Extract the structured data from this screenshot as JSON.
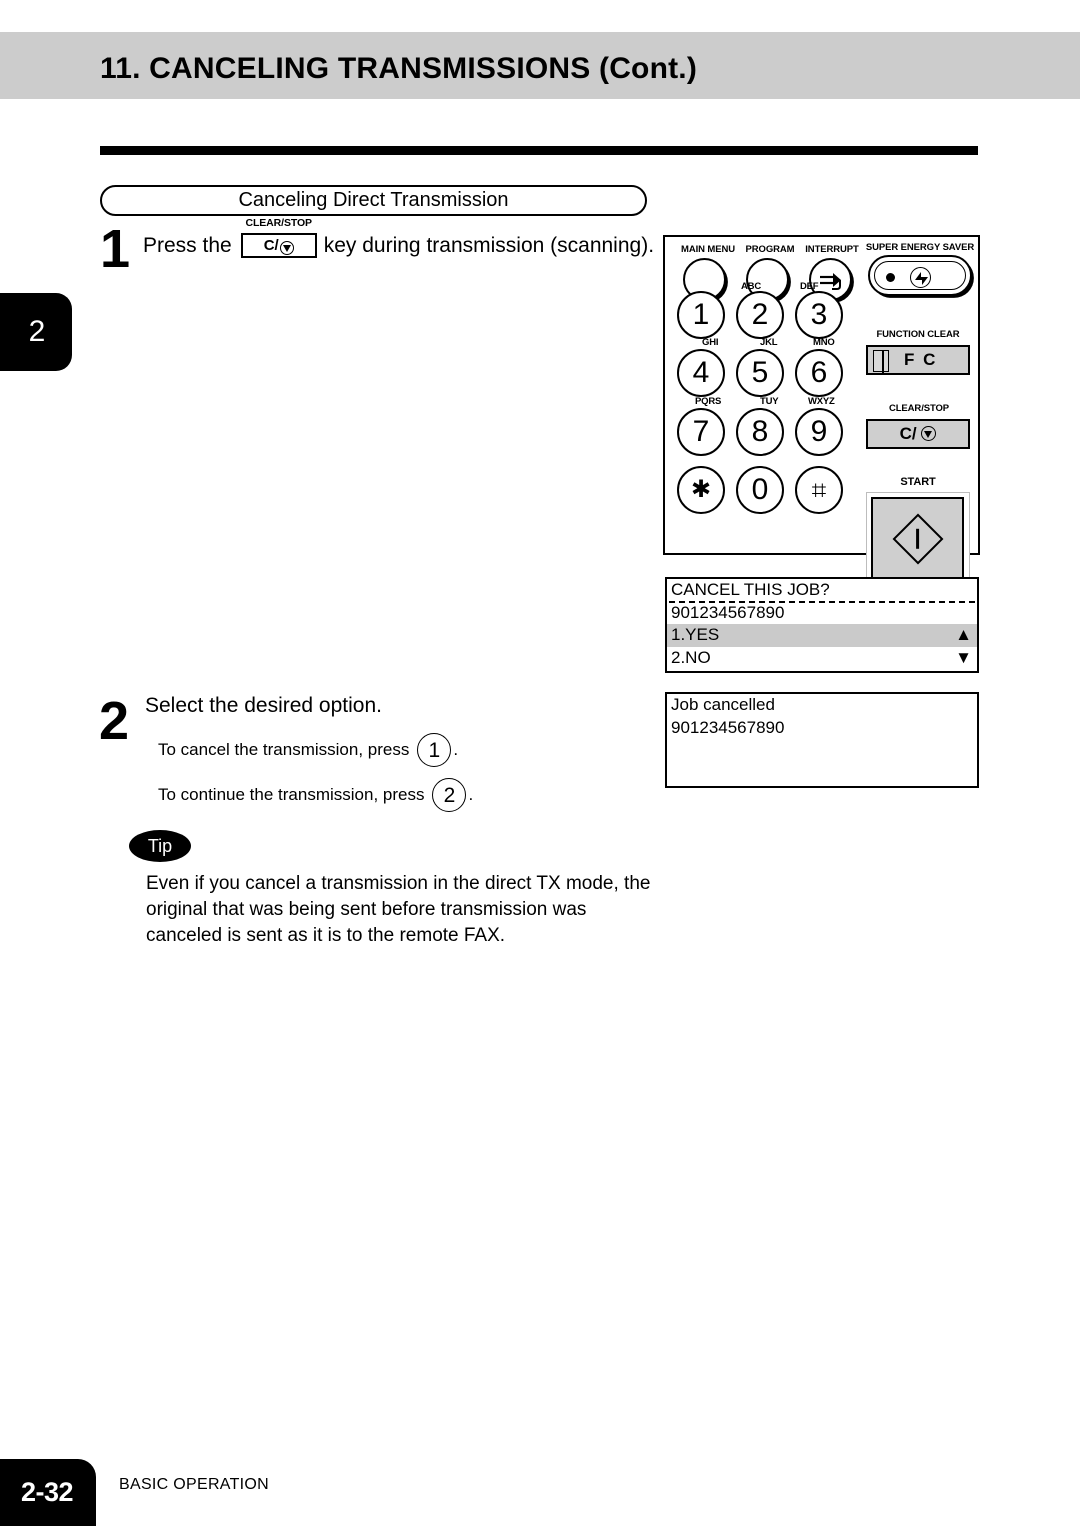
{
  "header": {
    "title_number": "11.",
    "title_main": "CANCELING TRANSMISSIONS",
    "title_cont": "(Cont.)",
    "title_full": "11. CANCELING TRANSMISSIONS (Cont.)",
    "band_color": "#cccccc"
  },
  "chapter_tab": {
    "number": "2"
  },
  "subheading": {
    "label": "Canceling Direct Transmission"
  },
  "steps": [
    {
      "number": "1",
      "text_before": "Press the",
      "inline_key": {
        "label_top": "CLEAR/STOP",
        "face": "C/"
      },
      "text_after": "key during transmission (scanning)."
    },
    {
      "number": "2",
      "title": "Select the desired option.",
      "sub_lines": [
        {
          "text_before": "To cancel the transmission, press",
          "key": "1",
          "text_after": "."
        },
        {
          "text_before": "To continue the transmission, press",
          "key": "2",
          "text_after": "."
        }
      ]
    }
  ],
  "tip": {
    "badge": "Tip",
    "body": "Even if you cancel a transmission in the direct TX mode, the original that was being sent before transmission was canceled is sent as it is to the remote FAX."
  },
  "control_panel": {
    "round_buttons": [
      {
        "label": "MAIN MENU",
        "icon": "blank-round-button"
      },
      {
        "label": "PROGRAM",
        "icon": "blank-round-button"
      },
      {
        "label": "INTERRUPT",
        "icon": "interrupt-arrow-icon"
      }
    ],
    "energy_saver": {
      "label": "SUPER ENERGY SAVER",
      "icon": "power-saver-icon"
    },
    "keypad": [
      {
        "digit": "1",
        "letters": ""
      },
      {
        "digit": "2",
        "letters": "ABC"
      },
      {
        "digit": "3",
        "letters": "DEF"
      },
      {
        "digit": "4",
        "letters": "GHI"
      },
      {
        "digit": "5",
        "letters": "JKL"
      },
      {
        "digit": "6",
        "letters": "MNO"
      },
      {
        "digit": "7",
        "letters": "PQRS"
      },
      {
        "digit": "8",
        "letters": "TUY"
      },
      {
        "digit": "9",
        "letters": "WXYZ"
      },
      {
        "digit": "✱",
        "letters": ""
      },
      {
        "digit": "0",
        "letters": ""
      },
      {
        "digit": "⌗",
        "letters": ""
      }
    ],
    "function_clear": {
      "label": "FUNCTION CLEAR",
      "face": "F C"
    },
    "clear_stop": {
      "label": "CLEAR/STOP",
      "face": "C/"
    },
    "start": {
      "label": "START",
      "icon": "start-diamond-icon"
    }
  },
  "lcd_panels": [
    {
      "name": "cancel-this-job-prompt",
      "rows": [
        {
          "text": "CANCEL THIS JOB?",
          "highlight": false,
          "arrow": ""
        },
        {
          "text": "901234567890",
          "highlight": false,
          "arrow": ""
        },
        {
          "text": "1.YES",
          "highlight": true,
          "arrow": "▲"
        },
        {
          "text": "2.NO",
          "highlight": false,
          "arrow": "▼"
        }
      ]
    },
    {
      "name": "job-cancelled-confirmation",
      "rows": [
        {
          "text": "Job cancelled",
          "highlight": false,
          "arrow": ""
        },
        {
          "text": "901234567890",
          "highlight": false,
          "arrow": ""
        },
        {
          "text": "",
          "highlight": false,
          "arrow": ""
        },
        {
          "text": "",
          "highlight": false,
          "arrow": ""
        }
      ]
    }
  ],
  "footer": {
    "page_number": "2-32",
    "section": "BASIC OPERATION"
  }
}
